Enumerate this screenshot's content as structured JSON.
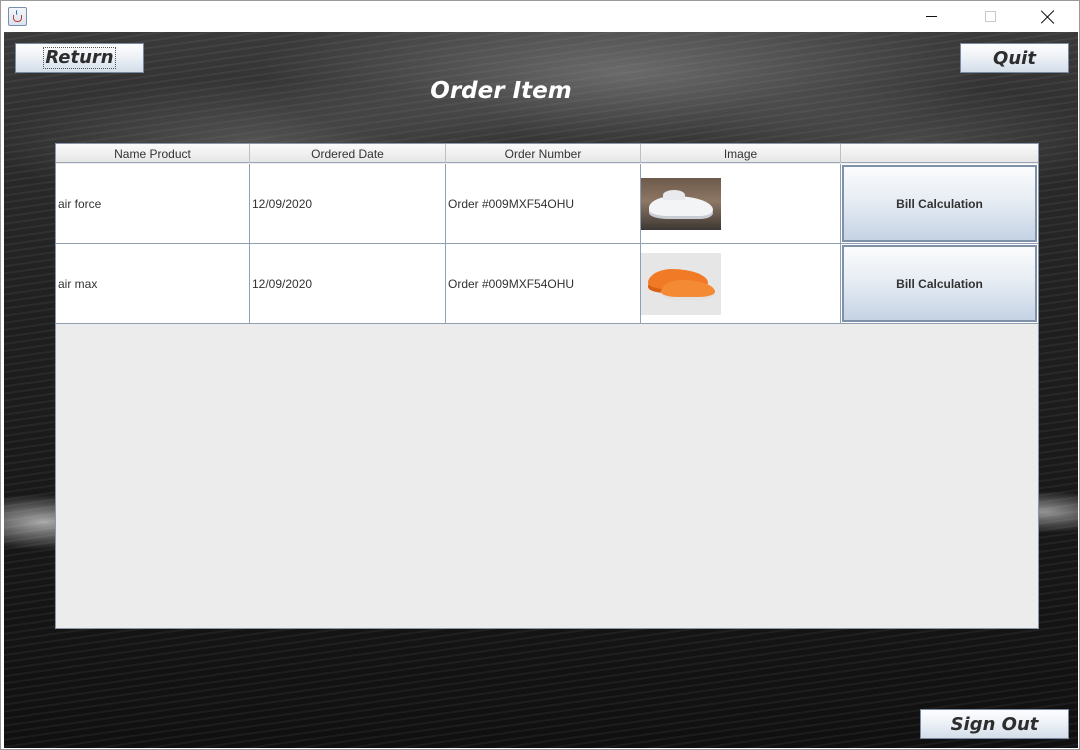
{
  "window": {
    "title": "",
    "controls": {
      "minimize": "minimize-icon",
      "maximize": "maximize-icon",
      "close": "close-icon"
    }
  },
  "header": {
    "return_label": "Return",
    "quit_label": "Quit",
    "title": "Order Item"
  },
  "table": {
    "columns": [
      "Name Product",
      "Ordered Date",
      "Order Number",
      "Image",
      ""
    ],
    "rows": [
      {
        "name": "air force",
        "date": "12/09/2020",
        "order_number": "Order #009MXF54OHU",
        "image": "white-sneaker-image",
        "action": "Bill Calculation"
      },
      {
        "name": "air max",
        "date": "12/09/2020",
        "order_number": "Order #009MXF54OHU",
        "image": "orange-sneaker-image",
        "action": "Bill Calculation"
      }
    ]
  },
  "footer": {
    "signout_label": "Sign Out"
  },
  "colors": {
    "button_gradient_top": "#fdfdfe",
    "button_gradient_bottom": "#d3dde9",
    "title_text": "#ffffff"
  }
}
